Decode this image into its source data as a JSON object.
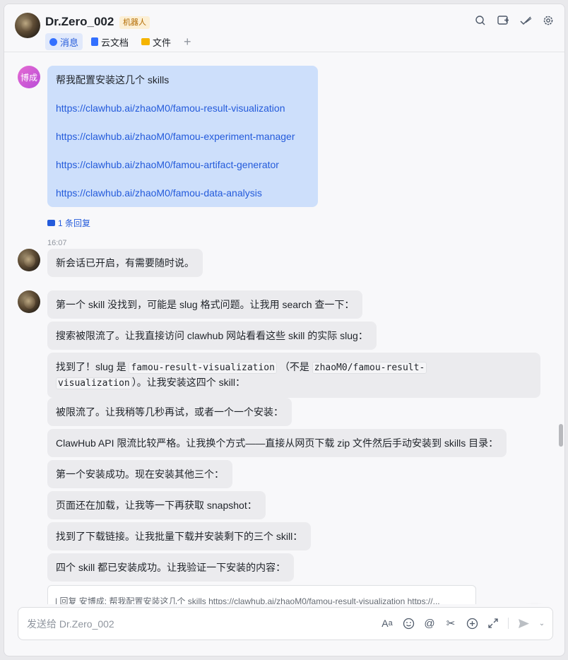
{
  "header": {
    "title": "Dr.Zero_002",
    "badge": "机器人",
    "tabs": [
      {
        "label": "消息",
        "icon": "chat-icon"
      },
      {
        "label": "云文档",
        "icon": "doc-icon"
      },
      {
        "label": "文件",
        "icon": "folder-icon"
      }
    ],
    "add_tab": "+"
  },
  "user_avatar_text": "博成",
  "request": {
    "text": "帮我配置安装这几个 skills",
    "links": [
      "https://clawhub.ai/zhaoM0/famou-result-visualization",
      "https://clawhub.ai/zhaoM0/famou-experiment-manager",
      "https://clawhub.ai/zhaoM0/famou-artifact-generator",
      "https://clawhub.ai/zhaoM0/famou-data-analysis"
    ],
    "reply_count": "1 条回复"
  },
  "time": "16:07",
  "bot_msg_1": "新会话已开启，有需要随时说。",
  "bot_msgs": [
    "第一个 skill 没找到，可能是 slug 格式问题。让我用 search 查一下：",
    "搜索被限流了。让我直接访问 clawhub 网站看看这些 skill 的实际 slug：",
    "被限流了。让我稍等几秒再试，或者一个一个安装：",
    "ClawHub API 限流比较严格。让我换个方式——直接从网页下载 zip 文件然后手动安装到 skills 目录：",
    "第一个安装成功。现在安装其他三个：",
    "页面还在加载，让我等一下再获取 snapshot：",
    "找到了下载链接。让我批量下载并安装剩下的三个 skill：",
    "四个 skill 都已安装成功。让我验证一下安装的内容："
  ],
  "slug_msg": {
    "part1": "找到了！slug 是 ",
    "code1": "famou-result-visualization",
    "part2": "（不是 ",
    "code2a": "zhaoM0/famou-result-",
    "code2b": "visualization",
    "part3": "）。让我安装这四个 skill："
  },
  "quote": "| 回复 安博成: 帮我配置安装这几个 skills https://clawhub.ai/zhaoM0/famou-result-visualization https://...",
  "composer": {
    "placeholder": "发送给 Dr.Zero_002"
  }
}
